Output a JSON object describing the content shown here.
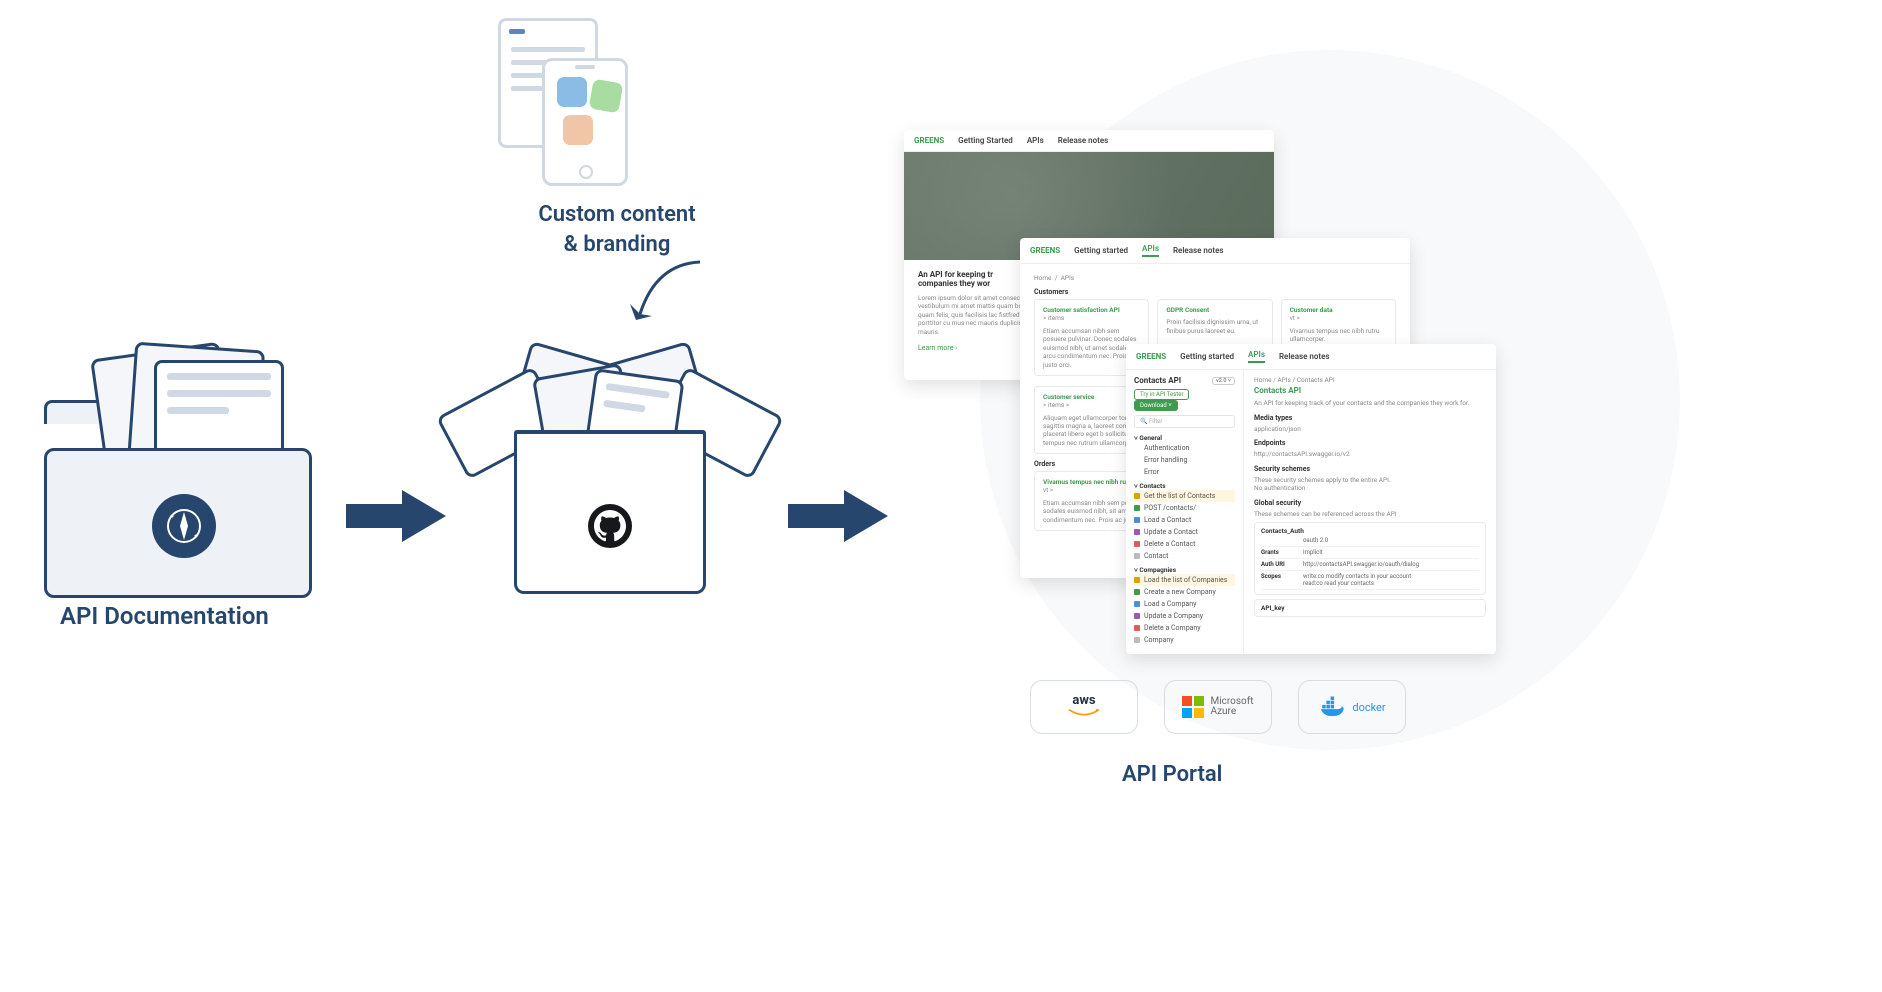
{
  "labels": {
    "left": "API Documentation",
    "center": "Custom content\n& branding",
    "right": "API Portal"
  },
  "deploy": {
    "aws": "aws",
    "azure1": "Microsoft",
    "azure2": "Azure",
    "docker": "docker"
  },
  "portal": {
    "logo": "GREENS",
    "nav1": [
      "Getting Started",
      "APIs",
      "Release notes"
    ],
    "nav2": [
      "Getting started",
      "APIs",
      "Release notes"
    ],
    "nav3": [
      "Getting started",
      "APIs",
      "Release notes"
    ],
    "card1": {
      "title": "An API for keeping tr",
      "sub": "companies they wor",
      "lorem": "Lorem ipsum dolor sit amet consectetur. Donec vestibulum mi amet mattis quam bonnesl, su quam felis, quis facilisis lac fistfred arcu porttitor cu mus nec mauris duplicis dictum mauris.",
      "link": "Learn more  ›"
    },
    "card2": {
      "breadcrumb": [
        "Home",
        "APIs"
      ],
      "h": "Customers",
      "cards": [
        {
          "title": "Customer satisfaction API",
          "meta": "> items",
          "desc": "Etiam accumsan nibh sem posuere pulvinar. Donec sodales euismod nibh, ut amet sodales arcu condimentum nec. Prois ac justo orci."
        },
        {
          "title": "GDPR Consent",
          "meta": "",
          "desc": "Proin facilisis dignissim urna, ut finibus purus laoreet eu."
        },
        {
          "title": "Customer data",
          "meta": "vt >",
          "desc": "Vivamus tempus nec nibh rutru ullamcorper."
        }
      ],
      "h2": "Customer service",
      "h2meta": "> items >",
      "h2desc": "Aliquam eget ullamcorper tortor. Morbi i nibh, tristique sagittis magna a, laoreet commodo odio. Proin placerat libero eget b sollicitudin viverra. Vivamus tempus nec rutrum ullamcorper. Praesent pulvinar lac",
      "h3": "Orders",
      "h3t": "Vivamus tempus nec nibh rutrum ullamcorper",
      "h3m": "vt >",
      "h3desc": "Etiam accumsan nibh sem posuere pulvinar. Donec sodales euismod nibh, sit amet sodales arcu condimentum nec. Prois ac justo orci."
    },
    "card3": {
      "breadcrumb": [
        "Home",
        "APIs",
        "Contacts API"
      ],
      "title": "Contacts API",
      "ver": "v2.0 ˅",
      "btn1": "Try in API Tester",
      "btn2": "Download ˅",
      "filter": "Filter",
      "sections": {
        "general": "General",
        "gen_items": [
          "Authentication",
          "Error handling",
          "Error"
        ],
        "contacts": "Contacts",
        "con_items": [
          {
            "c": "#d9a400",
            "t": "Get the list of Contacts"
          },
          {
            "c": "#3e9b4f",
            "t": "POST /contacts/"
          },
          {
            "c": "#4a90d9",
            "t": "Load a Contact"
          },
          {
            "c": "#9b59b6",
            "t": "Update a Contact"
          },
          {
            "c": "#e05c5c",
            "t": "Delete a Contact"
          },
          {
            "c": "#bbb",
            "t": "Contact"
          }
        ],
        "companies": "Compagnies",
        "comp_items": [
          {
            "c": "#d9a400",
            "t": "Load the list of Companies"
          },
          {
            "c": "#3e9b4f",
            "t": "Create a new Company"
          },
          {
            "c": "#4a90d9",
            "t": "Load a Company"
          },
          {
            "c": "#9b59b6",
            "t": "Update a Company"
          },
          {
            "c": "#e05c5c",
            "t": "Delete a Company"
          },
          {
            "c": "#bbb",
            "t": "Company"
          }
        ]
      },
      "right": {
        "h": "Contacts API",
        "desc": "An API for keeping track of your contacts and the companies they work for.",
        "media_h": "Media types",
        "media": "application/json",
        "ep_h": "Endpoints",
        "ep": "http://contactsAPI.swagger.io/v2",
        "sec_h": "Security schemes",
        "sec_d": "These security schemes apply to the entire API.",
        "sec_n": "No authentication",
        "gs_h": "Global security",
        "gs_d": "These schemes can be referenced across the API",
        "auth_t": "Contacts_Auth",
        "rows": [
          {
            "k": "",
            "v": "oauth 2.0"
          },
          {
            "k": "Grants",
            "v": "Implicit"
          },
          {
            "k": "Auth URI",
            "v": "http://contactsAPI.swagger.io/oauth/dialog"
          },
          {
            "k": "Scopes",
            "v": "write:co   modify contacts in your account\nread:co    read your contacts"
          }
        ],
        "key": "API_key"
      }
    }
  }
}
